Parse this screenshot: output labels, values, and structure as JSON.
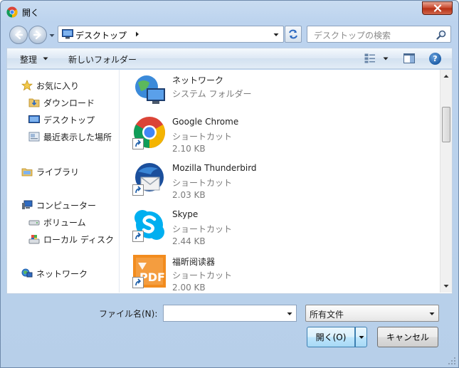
{
  "window": {
    "title": "開く",
    "icon": "chrome-icon"
  },
  "address_bar": {
    "location": "デスクトップ"
  },
  "search": {
    "placeholder": "デスクトップの検索"
  },
  "toolbar": {
    "organize_label": "整理",
    "new_folder_label": "新しいフォルダー"
  },
  "sidebar": {
    "favorites": {
      "label": "お気に入り",
      "items": [
        {
          "label": "ダウンロード",
          "icon": "download-folder-icon"
        },
        {
          "label": "デスクトップ",
          "icon": "desktop-icon"
        },
        {
          "label": "最近表示した場所",
          "icon": "recent-places-icon"
        }
      ]
    },
    "libraries": {
      "label": "ライブラリ"
    },
    "computer": {
      "label": "コンピューター",
      "items": [
        {
          "label": "ボリューム",
          "icon": "drive-icon"
        },
        {
          "label": "ローカル ディスク",
          "icon": "local-disk-icon"
        }
      ]
    },
    "network": {
      "label": "ネットワーク"
    }
  },
  "files": [
    {
      "name": "ネットワーク",
      "type": "システム フォルダー",
      "size": "",
      "icon": "network-globe-icon"
    },
    {
      "name": "Google Chrome",
      "type": "ショートカット",
      "size": "2.10 KB",
      "icon": "chrome-icon"
    },
    {
      "name": "Mozilla Thunderbird",
      "type": "ショートカット",
      "size": "2.03 KB",
      "icon": "thunderbird-icon"
    },
    {
      "name": "Skype",
      "type": "ショートカット",
      "size": "2.44 KB",
      "icon": "skype-icon"
    },
    {
      "name": "福昕阅读器",
      "type": "ショートカット",
      "size": "2.00 KB",
      "icon": "foxit-pdf-icon"
    }
  ],
  "bottom": {
    "filename_label": "ファイル名(N):",
    "filename_value": "",
    "filter_value": "所有文件",
    "open_label": "開く(O)",
    "cancel_label": "キャンセル"
  },
  "colors": {
    "titlebar": "#bcd3ee",
    "close": "#c7442a",
    "open_button": "#bee6fd",
    "accent": "#3c7fb1"
  }
}
